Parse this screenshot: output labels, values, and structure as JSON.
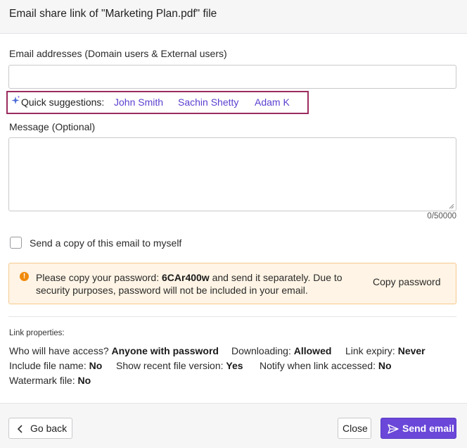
{
  "dialog": {
    "title": "Email share link of \"Marketing Plan.pdf\" file"
  },
  "email_field": {
    "label": "Email addresses (Domain users & External users)",
    "value": "",
    "placeholder": ""
  },
  "suggestions": {
    "icon": "sparkle-icon",
    "label": "Quick suggestions:",
    "names": [
      "John Smith",
      "Sachin Shetty",
      "Adam K"
    ],
    "highlight_color": "#9b2c5e",
    "link_color": "#5b3fcf"
  },
  "message_field": {
    "label": "Message (Optional)",
    "value": "",
    "counter": "0/50000"
  },
  "copy_to_self": {
    "label": "Send a copy of this email to myself",
    "checked": false
  },
  "password_notice": {
    "icon": "warning-icon",
    "text_before": "Please copy your password: ",
    "password": "6CAr400w",
    "text_after": " and send it separately. Due to security purposes, password will not be included in your email.",
    "copy_label": "Copy password",
    "background_color": "#fff4e5",
    "icon_color": "#f08a0b"
  },
  "link_properties": {
    "title": "Link properties:",
    "items": [
      {
        "label": "Who will have access? ",
        "value": "Anyone with password"
      },
      {
        "label": "Downloading: ",
        "value": "Allowed"
      },
      {
        "label": "Link expiry: ",
        "value": "Never"
      },
      {
        "label": "Include file name: ",
        "value": "No"
      },
      {
        "label": "Show recent file version: ",
        "value": "Yes"
      },
      {
        "label": "Notify when link accessed: ",
        "value": "No"
      },
      {
        "label": "Watermark file: ",
        "value": "No"
      }
    ]
  },
  "footer": {
    "back_label": "Go back",
    "close_label": "Close",
    "send_label": "Send email",
    "accent_color": "#6a47d8"
  }
}
